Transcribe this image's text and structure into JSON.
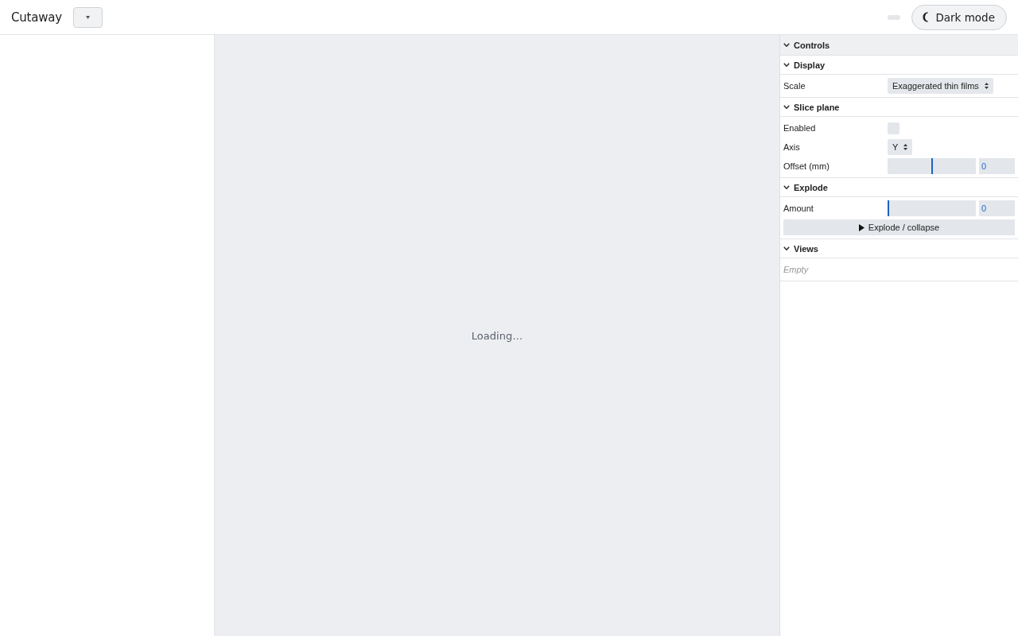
{
  "app": {
    "title": "Cutaway"
  },
  "header": {
    "dark_mode_button": {
      "label": "Dark mode"
    }
  },
  "viewport": {
    "status": "Loading…"
  },
  "panel": {
    "title": "Controls",
    "expanded": true,
    "sections": [
      {
        "title": "Display",
        "expanded": true,
        "rows": [
          {
            "kind": "select",
            "label": "Scale",
            "value": "Exaggerated thin films"
          }
        ]
      },
      {
        "title": "Slice plane",
        "expanded": true,
        "rows": [
          {
            "kind": "checkbox",
            "label": "Enabled",
            "checked": false
          },
          {
            "kind": "select",
            "label": "Axis",
            "value": "Y"
          },
          {
            "kind": "slider",
            "label": "Offset (mm)",
            "level": 0.5,
            "value": "0"
          }
        ]
      },
      {
        "title": "Explode",
        "expanded": true,
        "rows": [
          {
            "kind": "slider",
            "label": "Amount",
            "level": 0,
            "value": "0"
          },
          {
            "kind": "button",
            "label": "Explode / collapse"
          }
        ]
      },
      {
        "title": "Views",
        "expanded": true,
        "rows": [
          {
            "kind": "empty",
            "label": "Empty"
          }
        ]
      }
    ]
  }
}
